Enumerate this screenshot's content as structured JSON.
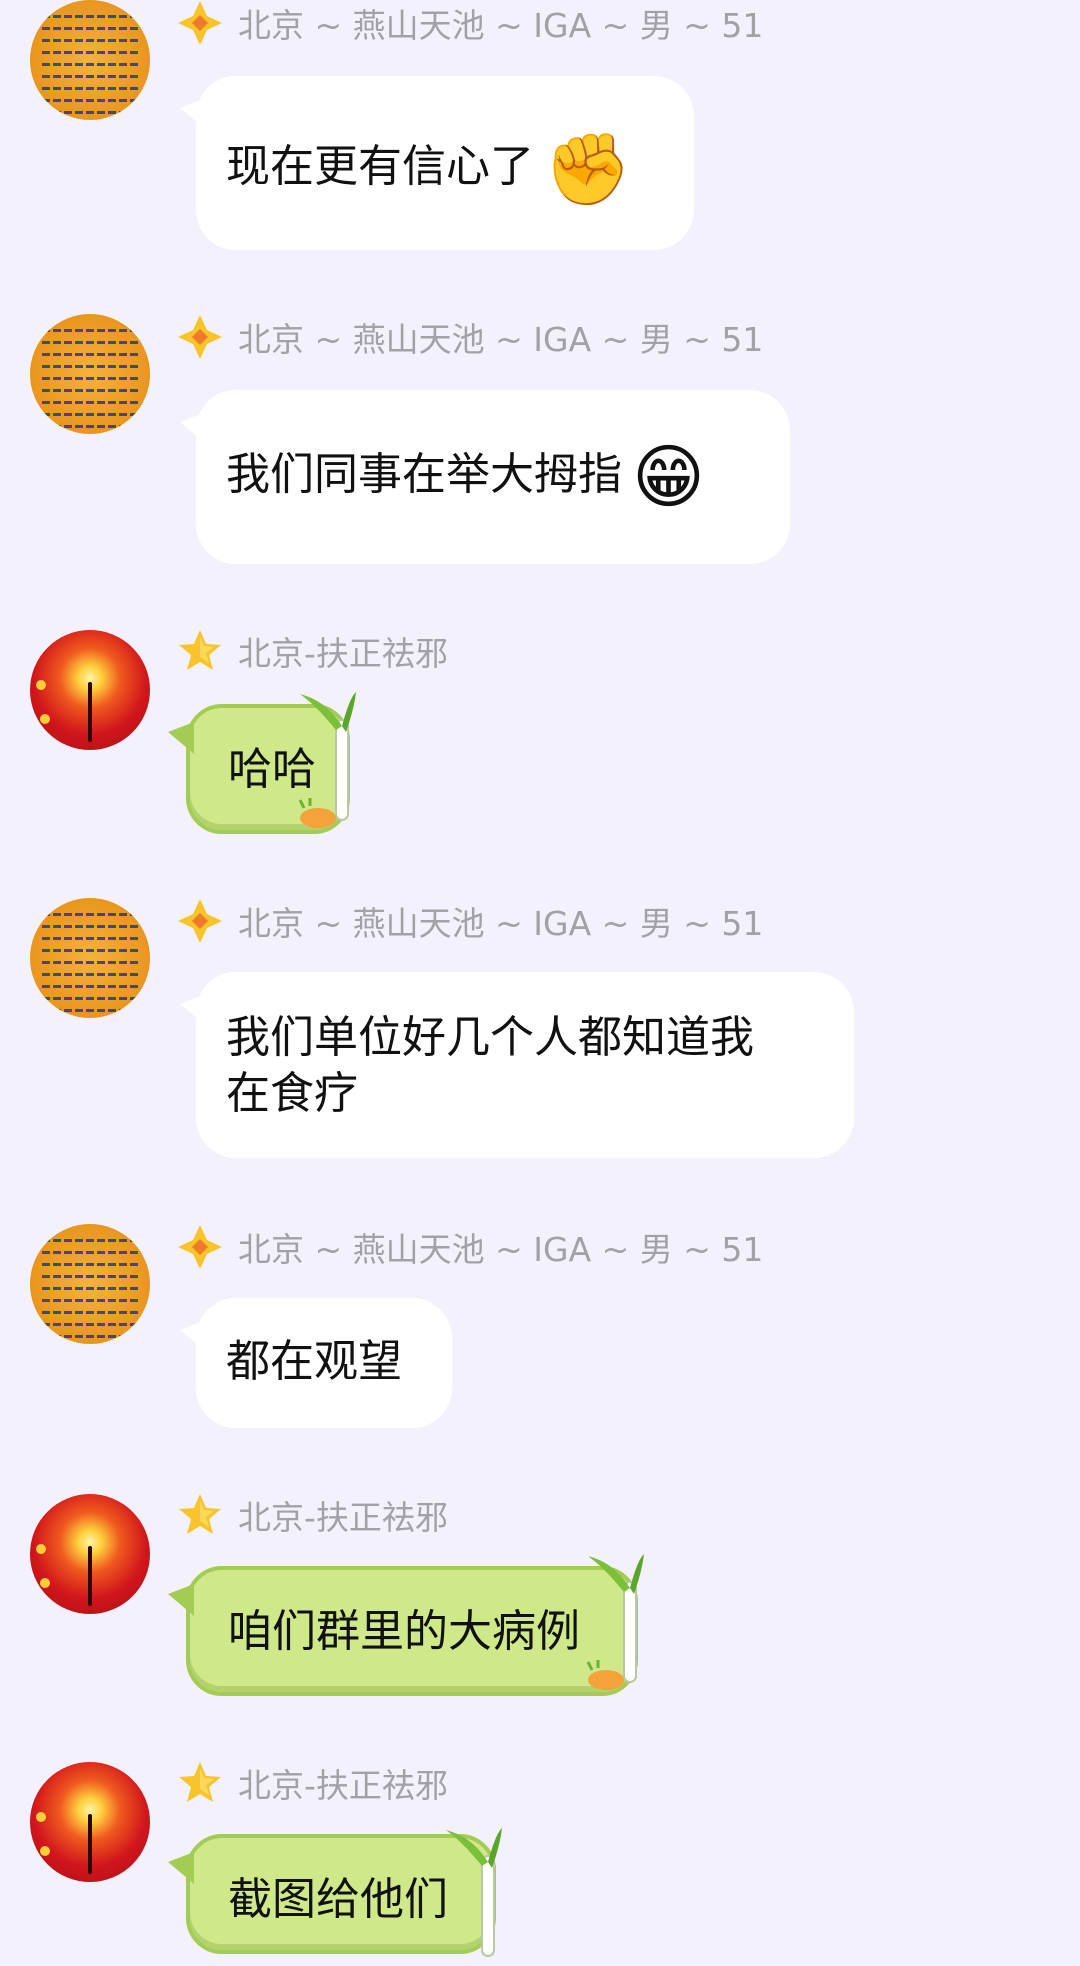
{
  "messages": [
    {
      "name": "北京 ~ 燕山天池 ~ IGA ~ 男 ~ 51",
      "text": "现在更有信心了",
      "emoji": "✊",
      "emoji_name": "raised-fist-icon"
    },
    {
      "name": "北京 ~ 燕山天池 ~ IGA ~ 男 ~ 51",
      "text": "我们同事在举大拇指",
      "emoji": "😁",
      "emoji_name": "grinning-face-icon"
    },
    {
      "name": "北京-扶正祛邪",
      "text": "哈哈"
    },
    {
      "name": "北京 ~ 燕山天池 ~ IGA ~ 男 ~ 51",
      "text_line1": "我们单位好几个人都知道我",
      "text_line2": "在食疗"
    },
    {
      "name": "北京 ~ 燕山天池 ~ IGA ~ 男 ~ 51",
      "text": "都在观望"
    },
    {
      "name": "北京-扶正祛邪",
      "text": "咱们群里的大病例"
    },
    {
      "name": "北京-扶正祛邪",
      "text": "截图给他们"
    }
  ],
  "colors": {
    "background": "#f3f1fb",
    "bubble_white": "#ffffff",
    "bubble_green": "#cfe98a",
    "name_gray": "#a3a1a8",
    "badge_gold": "#f7c52a"
  }
}
